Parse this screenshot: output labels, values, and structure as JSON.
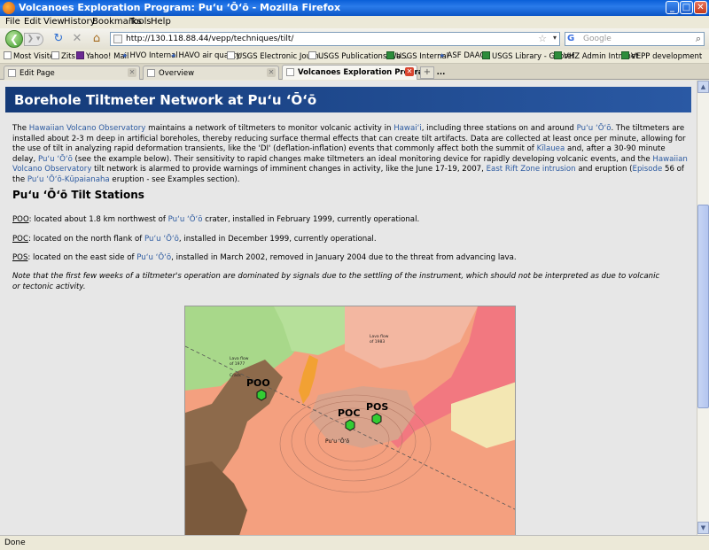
{
  "window": {
    "title": "Volcanoes Exploration Program: Pu‘u ‘Ō‘ō - Mozilla Firefox",
    "minimize": "_",
    "maximize": "□",
    "close": "✕"
  },
  "menu": [
    "File",
    "Edit",
    "View",
    "History",
    "Bookmarks",
    "Tools",
    "Help"
  ],
  "nav": {
    "url": "http://130.118.88.44/vepp/techniques/tilt/",
    "search_placeholder": "Google"
  },
  "bookmarks": [
    "Most Visited",
    "Zits",
    "Yahoo! Mail",
    "HVO Internal",
    "HAVO air quality",
    "USGS Electronic Journ...",
    "USGS Publications Wa...",
    "USGS Internal",
    "ASF DAAC",
    "USGS Library - Georef",
    "VHZ Admin Intranet",
    "VEPP development"
  ],
  "tabs": [
    {
      "label": "Edit Page"
    },
    {
      "label": "Overview"
    },
    {
      "label": "Volcanoes Exploration Program: ..."
    }
  ],
  "page": {
    "banner": "Borehole Tiltmeter Network at Pu‘u ‘Ō‘ō",
    "intro": {
      "t1": "The ",
      "l_hvo": "Hawaiian Volcano Observatory",
      "t2": " maintains a network of tiltmeters to monitor volcanic activity in ",
      "l_hawaii": "Hawai‘i",
      "t3": ", including three stations on and around ",
      "l_puuoo1": "Pu‘u ‘Ō‘ō",
      "t4": ". The tiltmeters are installed about 2-3 m deep in artificial boreholes, thereby reducing surface thermal effects that can create tilt artifacts. Data are collected at least once per minute, allowing for the use of tilt in analyzing rapid deformation transients, like the 'DI' (deflation-inflation) events that commonly affect both the summit of ",
      "l_kilauea": "Kīlauea",
      "t5": " and, after a 30-90 minute delay, ",
      "l_puuoo2": "Pu‘u ‘Ō‘ō",
      "t6": " (see the example below). Their sensitivity to rapid changes make tiltmeters an ideal monitoring device for rapidly developing volcanic events, and the ",
      "l_hvo2": "Hawaiian Volcano Observatory",
      "t7": " tilt network is alarmed to provide warnings of imminent changes in activity, like the June 17-19, 2007, ",
      "l_erz": "East Rift Zone intrusion",
      "t8": " and eruption (",
      "l_episode": "Episode",
      "t9": " 56 of the ",
      "l_kupaianaha": "Pu‘u ‘Ō‘ō-Kūpaianaha",
      "t10": " eruption - see Examples section)."
    },
    "stations_heading": "Pu‘u ‘Ō‘ō Tilt Stations",
    "stations": [
      {
        "code": "POO",
        "pre": ": located about 1.8 km northwest of ",
        "link": "Pu‘u ‘Ō‘ō",
        "post": " crater, installed in February 1999, currently operational."
      },
      {
        "code": "POC",
        "pre": ": located on the north flank of ",
        "link": "Pu‘u ‘Ō‘ō",
        "post": ", installed in December 1999, currently operational."
      },
      {
        "code": "POS",
        "pre": ": located on the east side of ",
        "link": "Pu‘u ‘Ō‘ō",
        "post": ", installed in March 2002, removed in January 2004 due to the threat from advancing lava."
      }
    ],
    "note": "Note that the first few weeks of a tiltmeter's operation are dominated by signals due to the settling of the instrument, which should not be interpreted as due to volcanic or tectonic activity.",
    "map": {
      "labels": [
        "POO",
        "POC",
        "POS"
      ],
      "vent_label": "Pu‘u ‘Ō‘ō",
      "small_text": [
        "Lava flow",
        "of 1977",
        "Crack",
        "Lava flow",
        "of 1983"
      ]
    }
  },
  "status": "Done",
  "colors": {
    "map_salmon": "#f4a07f",
    "map_brown": "#8d6a4b",
    "map_green": "#a8d88a",
    "map_pink": "#f27880",
    "station_green": "#33cc33"
  }
}
